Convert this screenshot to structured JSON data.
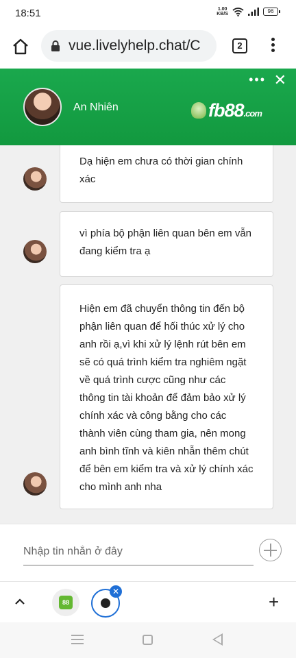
{
  "status_bar": {
    "time": "18:51",
    "net_speed_value": "1.00",
    "net_speed_unit": "KB/S",
    "battery": "96"
  },
  "browser": {
    "url": "vue.livelyhelp.chat/C",
    "tab_count": "2"
  },
  "chat_header": {
    "agent_name": "An Nhiên",
    "brand_text": "fb88",
    "brand_suffix": ".com",
    "menu_dots": "•••",
    "close_glyph": "✕"
  },
  "messages": [
    {
      "text": "Dạ hiện em chưa có thời gian chính xác"
    },
    {
      "text": "vì phía bộ phận liên quan bên em vẫn đang kiểm tra ạ"
    },
    {
      "text": "Hiện em đã chuyển thông tin đến bộ phận liên quan để hối thúc xử lý cho anh rồi ạ,vì khi xử lý lệnh rút bên em sẽ có quá trình kiểm tra nghiêm ngặt về quá trình cược cũng như các thông tin tài khoản để đảm bảo xử lý chính xác và công bằng cho các thành viên cùng tham gia, nên mong anh bình tĩnh và kiên nhẫn thêm chút để bên em kiểm tra và xử lý chính xác cho mình anh nha"
    }
  ],
  "input": {
    "placeholder": "Nhập tin nhắn ở đây"
  },
  "bottom_tabs": {
    "chevron": "^",
    "tab1_badge": "88",
    "tab_close": "✕",
    "plus": "+"
  }
}
